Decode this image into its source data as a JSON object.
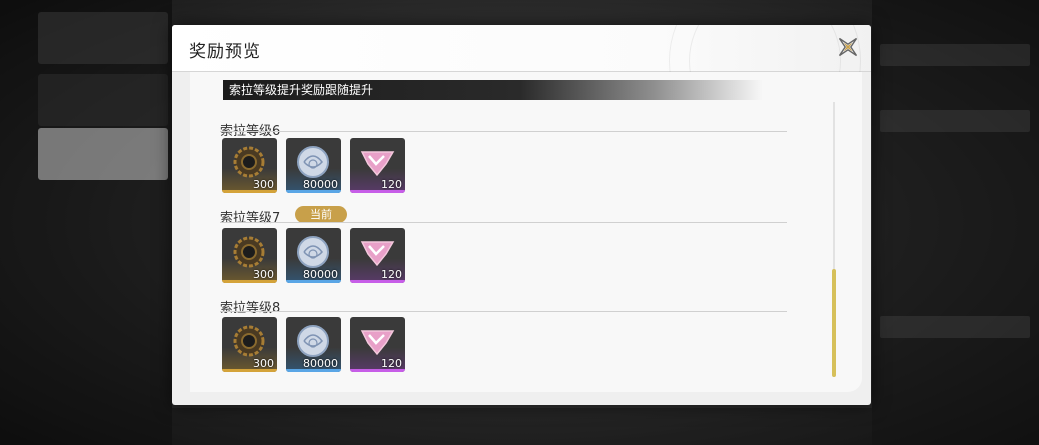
{
  "modal": {
    "title": "奖励预览",
    "banner": "索拉等级提升奖励跟随提升",
    "current_badge": "当前"
  },
  "sections": [
    {
      "label": "索拉等级6",
      "items": [
        {
          "icon": "gear-material-icon",
          "qty": "300",
          "rarity": "gold"
        },
        {
          "icon": "shell-coin-icon",
          "qty": "80000",
          "rarity": "blue"
        },
        {
          "icon": "heart-ticket-icon",
          "qty": "120",
          "rarity": "purple"
        }
      ]
    },
    {
      "label": "索拉等级7",
      "current": true,
      "items": [
        {
          "icon": "gear-material-icon",
          "qty": "300",
          "rarity": "gold"
        },
        {
          "icon": "shell-coin-icon",
          "qty": "80000",
          "rarity": "blue"
        },
        {
          "icon": "heart-ticket-icon",
          "qty": "120",
          "rarity": "purple"
        }
      ]
    },
    {
      "label": "索拉等级8",
      "items": [
        {
          "icon": "gear-material-icon",
          "qty": "300",
          "rarity": "gold"
        },
        {
          "icon": "shell-coin-icon",
          "qty": "80000",
          "rarity": "blue"
        },
        {
          "icon": "heart-ticket-icon",
          "qty": "120",
          "rarity": "purple"
        }
      ]
    }
  ],
  "colors": {
    "accent_gold": "#c8a04a",
    "rarity_gold": "#d4a33a",
    "rarity_blue": "#5aa6e6",
    "rarity_purple": "#c75ee8",
    "scroll_thumb": "#d6c05a"
  }
}
